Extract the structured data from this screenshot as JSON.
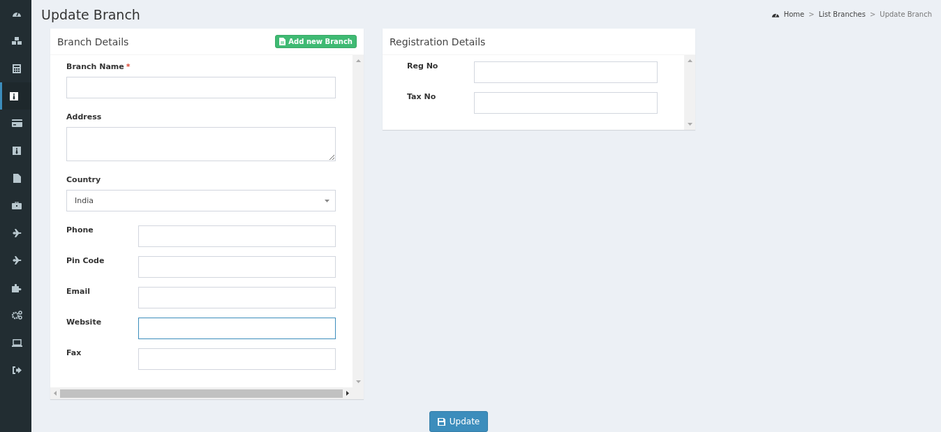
{
  "sidebar": {
    "items": [
      {
        "selected": false
      },
      {
        "selected": false
      },
      {
        "selected": false
      },
      {
        "selected": true
      },
      {
        "selected": false
      },
      {
        "selected": false
      },
      {
        "selected": false
      },
      {
        "selected": false
      },
      {
        "selected": false
      },
      {
        "selected": false
      },
      {
        "selected": false
      },
      {
        "selected": false
      },
      {
        "selected": false
      },
      {
        "selected": false
      }
    ]
  },
  "page": {
    "title": "Update Branch"
  },
  "breadcrumb": [
    {
      "label": "Home",
      "current": false
    },
    {
      "separator": ">",
      "label": "List Branches",
      "current": false
    },
    {
      "separator": ">",
      "label": "Update Branch",
      "current": true
    }
  ],
  "branch_details": {
    "title": "Branch Details",
    "add_button": "Add new Branch",
    "fields": [
      {
        "label": "Branch Name",
        "required_mark": "*",
        "kind": "text",
        "focused": false
      },
      {
        "label": "Address",
        "kind": "textarea",
        "focused": false
      },
      {
        "label": "Country",
        "kind": "select",
        "value": "India",
        "focused": false
      },
      {
        "label": "Phone",
        "kind": "inline",
        "focused": false
      },
      {
        "label": "Pin Code",
        "kind": "inline",
        "focused": false
      },
      {
        "label": "Email",
        "kind": "inline",
        "focused": false
      },
      {
        "label": "Website",
        "kind": "inline",
        "focused": true
      },
      {
        "label": "Fax",
        "kind": "inline",
        "focused": false
      }
    ]
  },
  "registration_details": {
    "title": "Registration Details",
    "fields": [
      {
        "label": "Reg No",
        "kind": "text",
        "focused": false
      },
      {
        "label": "Tax No",
        "kind": "text",
        "focused": false
      }
    ]
  },
  "update_button": "Update"
}
